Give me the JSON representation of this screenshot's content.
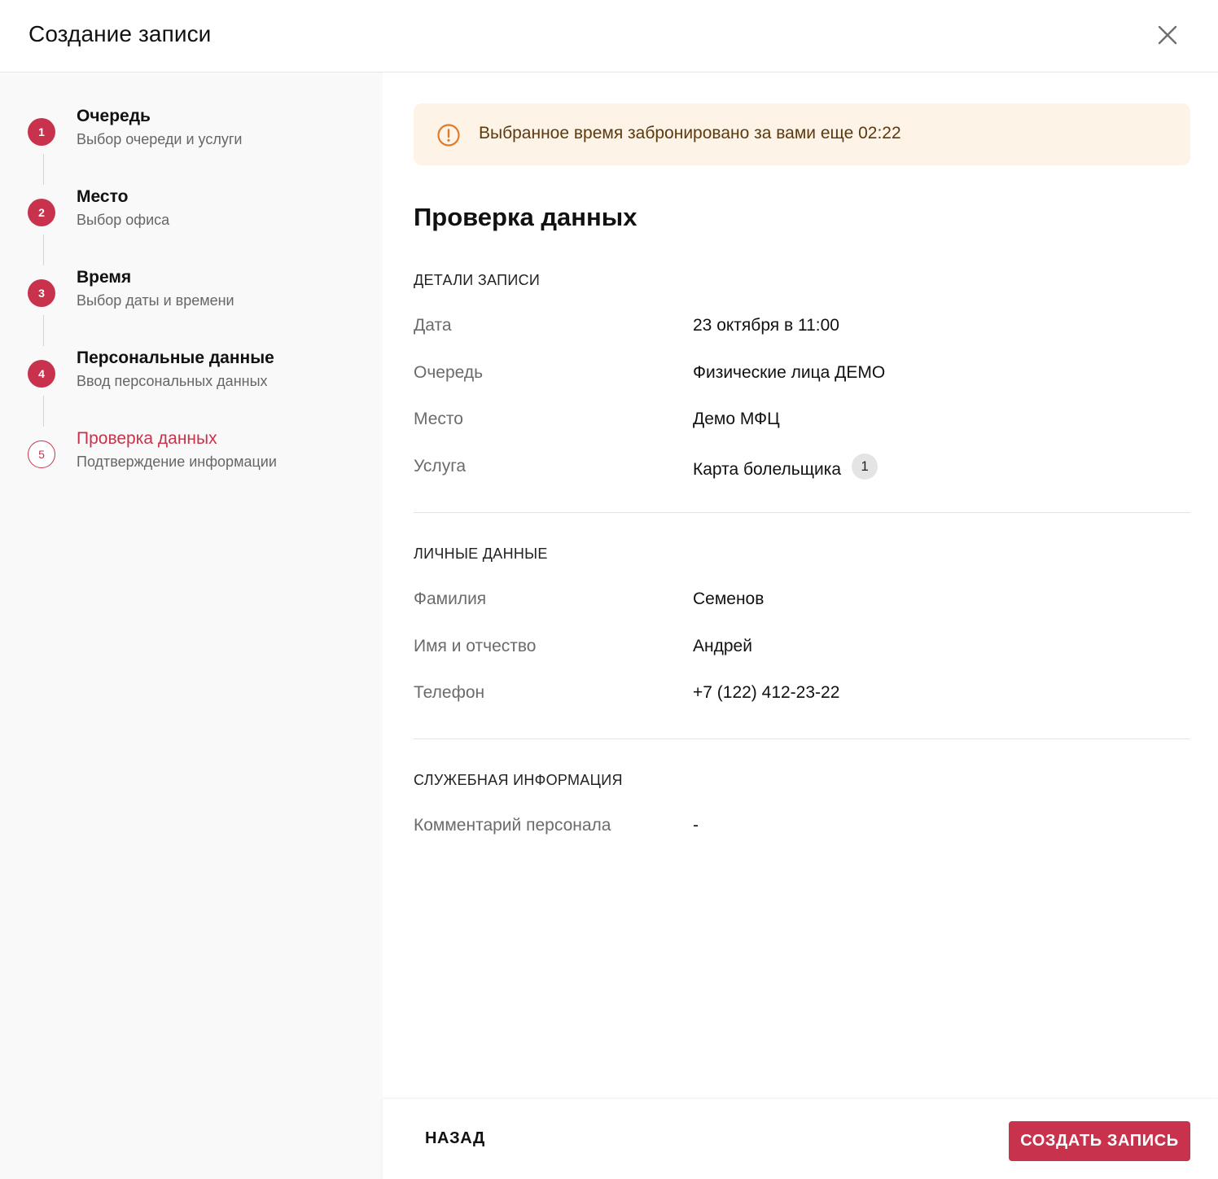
{
  "header": {
    "title": "Создание записи"
  },
  "steps": [
    {
      "number": "1",
      "label": "Очередь",
      "sub": "Выбор очереди и услуги",
      "state": "done"
    },
    {
      "number": "2",
      "label": "Место",
      "sub": "Выбор офиса",
      "state": "done"
    },
    {
      "number": "3",
      "label": "Время",
      "sub": "Выбор даты и времени",
      "state": "done"
    },
    {
      "number": "4",
      "label": "Персональные данные",
      "sub": "Ввод персональных данных",
      "state": "done"
    },
    {
      "number": "5",
      "label": "Проверка данных",
      "sub": "Подтверждение информации",
      "state": "active"
    }
  ],
  "alert": {
    "text": "Выбранное время забронировано за вами еще 02:22"
  },
  "page_title": "Проверка данных",
  "sections": {
    "details": {
      "title": "ДЕТАЛИ ЗАПИСИ",
      "rows": [
        {
          "label": "Дата",
          "value": "23 октября в 11:00"
        },
        {
          "label": "Очередь",
          "value": "Физические лица ДЕМО"
        },
        {
          "label": "Место",
          "value": "Демо МФЦ"
        },
        {
          "label": "Услуга",
          "value": "Карта болельщика",
          "badge": "1"
        }
      ]
    },
    "personal": {
      "title": "ЛИЧНЫЕ ДАННЫЕ",
      "rows": [
        {
          "label": "Фамилия",
          "value": "Семенов"
        },
        {
          "label": "Имя и отчество",
          "value": "Андрей"
        },
        {
          "label": "Телефон",
          "value": "+7 (122) 412-23-22"
        }
      ]
    },
    "service": {
      "title": "СЛУЖЕБНАЯ ИНФОРМАЦИЯ",
      "rows": [
        {
          "label": "Комментарий персонала",
          "value": "-"
        }
      ]
    }
  },
  "footer": {
    "back_label": "НАЗАД",
    "create_label": "СОЗДАТЬ ЗАПИСЬ"
  },
  "colors": {
    "accent": "#c8324c",
    "alert_bg": "#fdf3e6",
    "alert_icon": "#e07b2a",
    "sidebar_bg": "#f9f9f9"
  },
  "icons": {
    "close": "close-icon",
    "alert": "exclamation-circle-icon"
  }
}
